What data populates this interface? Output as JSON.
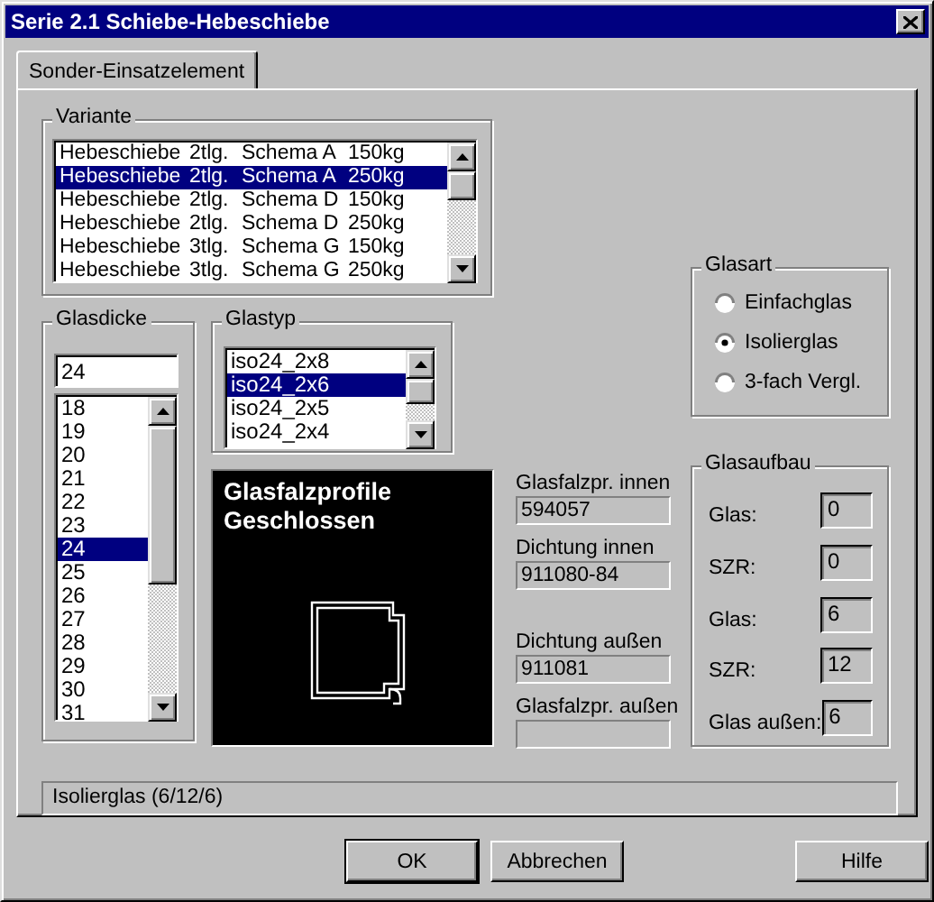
{
  "window": {
    "title": "Serie 2.1 Schiebe-Hebeschiebe"
  },
  "tabs": [
    {
      "label": "Sonder-Einsatzelement",
      "selected": true
    }
  ],
  "variante": {
    "label": "Variante",
    "rows": [
      {
        "cells": [
          "Hebeschiebe",
          "2tlg.",
          "Schema A",
          "150kg"
        ],
        "selected": false
      },
      {
        "cells": [
          "Hebeschiebe",
          "2tlg.",
          "Schema A",
          "250kg"
        ],
        "selected": true
      },
      {
        "cells": [
          "Hebeschiebe",
          "2tlg.",
          "Schema D",
          "150kg"
        ],
        "selected": false
      },
      {
        "cells": [
          "Hebeschiebe",
          "2tlg.",
          "Schema D",
          "250kg"
        ],
        "selected": false
      },
      {
        "cells": [
          "Hebeschiebe",
          "3tlg.",
          "Schema G",
          "150kg"
        ],
        "selected": false
      },
      {
        "cells": [
          "Hebeschiebe",
          "3tlg.",
          "Schema G",
          "250kg"
        ],
        "selected": false
      }
    ]
  },
  "glasart": {
    "label": "Glasart",
    "options": [
      {
        "label": "Einfachglas",
        "selected": false
      },
      {
        "label": "Isolierglas",
        "selected": true
      },
      {
        "label": "3-fach Vergl.",
        "selected": false
      }
    ]
  },
  "glasdicke": {
    "label": "Glasdicke",
    "value": "24",
    "items": [
      {
        "label": "18",
        "selected": false
      },
      {
        "label": "19",
        "selected": false
      },
      {
        "label": "20",
        "selected": false
      },
      {
        "label": "21",
        "selected": false
      },
      {
        "label": "22",
        "selected": false
      },
      {
        "label": "23",
        "selected": false
      },
      {
        "label": "24",
        "selected": true
      },
      {
        "label": "25",
        "selected": false
      },
      {
        "label": "26",
        "selected": false
      },
      {
        "label": "27",
        "selected": false
      },
      {
        "label": "28",
        "selected": false
      },
      {
        "label": "29",
        "selected": false
      },
      {
        "label": "30",
        "selected": false
      },
      {
        "label": "31",
        "selected": false
      }
    ]
  },
  "glastyp": {
    "label": "Glastyp",
    "items": [
      {
        "label": "iso24_2x8",
        "selected": false
      },
      {
        "label": "iso24_2x6",
        "selected": true
      },
      {
        "label": "iso24_2x5",
        "selected": false
      },
      {
        "label": "iso24_2x4",
        "selected": false
      }
    ]
  },
  "profile_view": {
    "lines": [
      "Glasfalzprofile",
      "Geschlossen"
    ]
  },
  "fields": [
    {
      "label": "Glasfalzpr. innen",
      "value": "594057"
    },
    {
      "label": "Dichtung innen",
      "value": "911080-84"
    },
    {
      "label": "Dichtung außen",
      "value": "911081"
    },
    {
      "label": "Glasfalzpr. außen"
    }
  ],
  "glasaufbau": {
    "label": "Glasaufbau",
    "rows": [
      {
        "label": "Glas:",
        "value": "0"
      },
      {
        "label": "SZR:",
        "value": "0"
      },
      {
        "label": "Glas:",
        "value": "6"
      },
      {
        "label": "SZR:",
        "value": "12"
      },
      {
        "label": "Glas außen:",
        "value": "6"
      }
    ]
  },
  "status": "Isolierglas (6/12/6)",
  "buttons": [
    {
      "label": "OK",
      "kind": "default"
    },
    {
      "label": "Abbrechen",
      "kind": "normal"
    },
    {
      "label": "Hilfe",
      "kind": "help"
    }
  ]
}
